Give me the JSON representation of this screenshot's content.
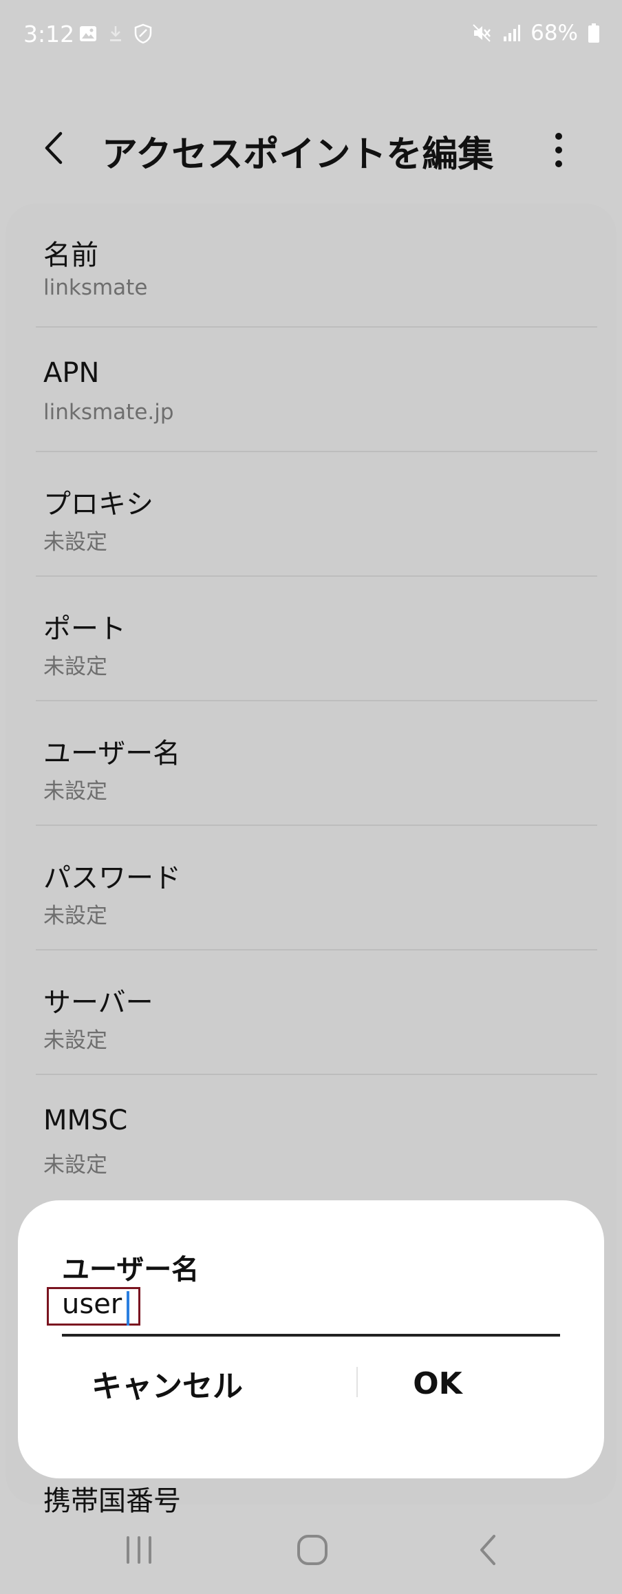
{
  "status_bar": {
    "time": "3:12",
    "battery": "68%",
    "left_icons": [
      "image-icon",
      "download-icon",
      "shield-icon"
    ],
    "right_icons": [
      "mute-icon",
      "signal-icon",
      "battery-icon"
    ]
  },
  "header": {
    "title": "アクセスポイントを編集"
  },
  "settings": [
    {
      "label": "名前",
      "value": "linksmate"
    },
    {
      "label": "APN",
      "value": "linksmate.jp"
    },
    {
      "label": "プロキシ",
      "value": "未設定"
    },
    {
      "label": "ポート",
      "value": "未設定"
    },
    {
      "label": "ユーザー名",
      "value": "未設定"
    },
    {
      "label": "パスワード",
      "value": "未設定"
    },
    {
      "label": "サーバー",
      "value": "未設定"
    },
    {
      "label": "MMSC",
      "value": "未設定"
    }
  ],
  "peek_item": {
    "label": "携帯国番号"
  },
  "dialog": {
    "title": "ユーザー名",
    "input_value": "user",
    "cancel_label": "キャンセル",
    "ok_label": "OK"
  },
  "colors": {
    "background": "#cfcfcf",
    "dialog": "#ffffff",
    "cursor": "#2a7fe0",
    "highlight_box": "#7a1420"
  }
}
